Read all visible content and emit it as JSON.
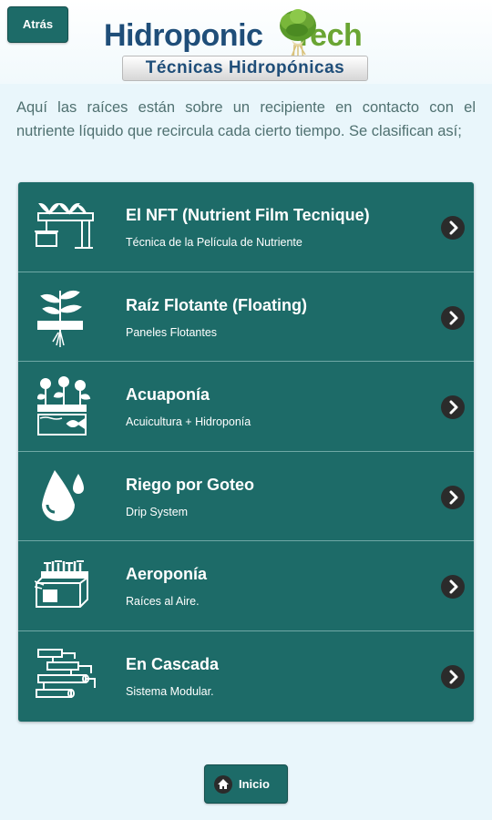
{
  "header": {
    "back_label": "Atrás",
    "logo": {
      "word1": "Hidroponic",
      "word2": "Tech",
      "subtitle": "Técnicas Hidropónicas"
    }
  },
  "intro": "Aquí las raíces están sobre un recipiente en contacto con el nutriente líquido que recircula cada cierto tiempo. Se clasifican así;",
  "techniques": [
    {
      "title": "El NFT (Nutrient Film Tecnique)",
      "subtitle": "Técnica de la Película de Nutriente",
      "icon": "nft-icon"
    },
    {
      "title": "Raíz Flotante (Floating)",
      "subtitle": "Paneles Flotantes",
      "icon": "floating-raft-icon"
    },
    {
      "title": "Acuaponía",
      "subtitle": "Acuicultura + Hidroponía",
      "icon": "aquaponics-icon"
    },
    {
      "title": "Riego por Goteo",
      "subtitle": "Drip System",
      "icon": "water-drops-icon"
    },
    {
      "title": "Aeroponía",
      "subtitle": "Raíces al Aire.",
      "icon": "aeroponics-icon"
    },
    {
      "title": "En Cascada",
      "subtitle": "Sistema Modular.",
      "icon": "cascade-pipes-icon"
    }
  ],
  "footer": {
    "home_label": "Inicio"
  },
  "colors": {
    "accent": "#1d6b68",
    "divider": "#6fa8a6",
    "text": "#507171",
    "background": "#e9f6fb"
  }
}
